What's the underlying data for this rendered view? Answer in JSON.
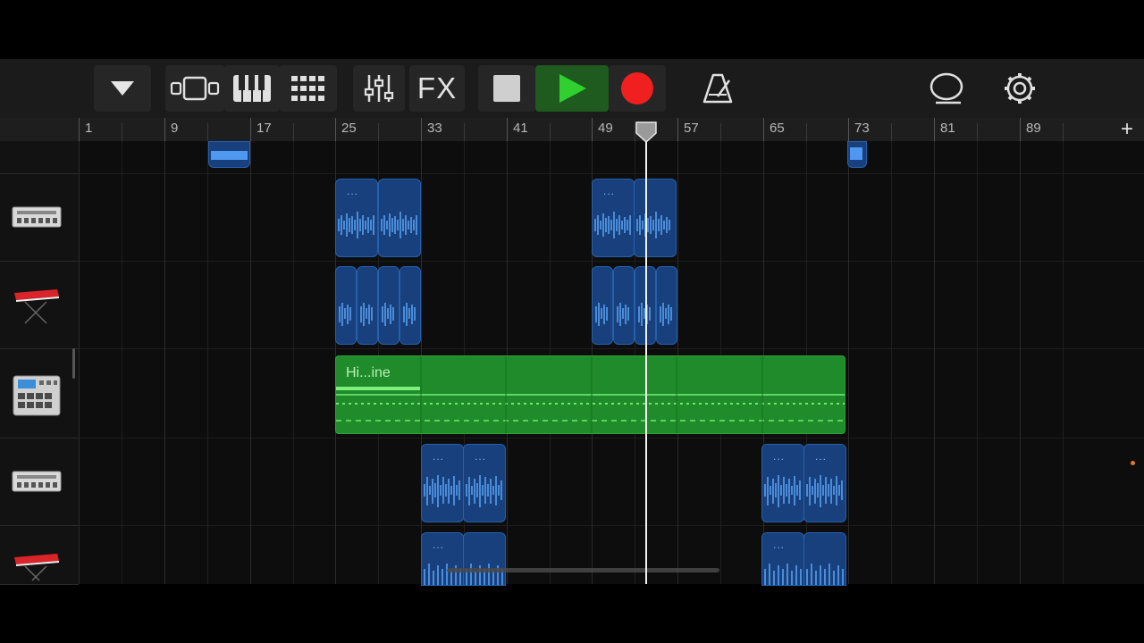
{
  "toolbar": {
    "fx_label": "FX",
    "colors": {
      "play": "#2fd02f",
      "record": "#f02020",
      "play_bg": "#1f5a1f"
    }
  },
  "ruler": {
    "labels": [
      "1",
      "9",
      "17",
      "25",
      "33",
      "41",
      "49",
      "57",
      "65",
      "73",
      "81",
      "89"
    ],
    "add_label": "+"
  },
  "tracks": [
    {
      "instrument": "drum-machine-silver-icon"
    },
    {
      "instrument": "red-keyboard-icon"
    },
    {
      "instrument": "beat-pad-sampler-icon"
    },
    {
      "instrument": "drum-machine-silver-icon"
    },
    {
      "instrument": "red-keyboard-icon"
    }
  ],
  "regions": {
    "green_title": "Hi...ine",
    "dots": "..."
  }
}
